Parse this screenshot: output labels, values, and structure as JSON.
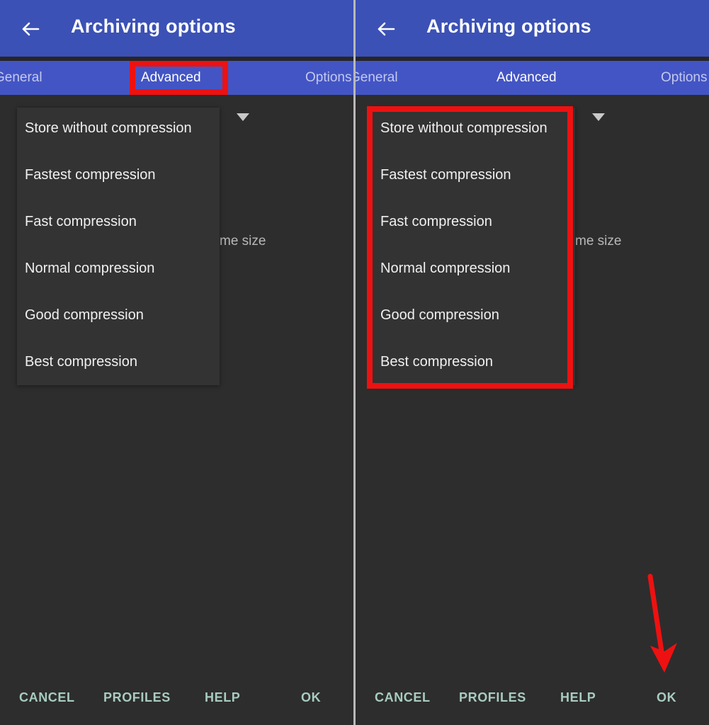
{
  "app": {
    "title": "Archiving options",
    "back_icon": "arrow-left-icon"
  },
  "tabs": {
    "general": "General",
    "advanced": "Advanced",
    "options": "Options",
    "selected": "Advanced"
  },
  "dropdown": {
    "caret_icon": "chevron-down-icon",
    "items": [
      "Store without compression",
      "Fastest compression",
      "Fast compression",
      "Normal compression",
      "Good compression",
      "Best compression"
    ]
  },
  "form": {
    "partial_label": "me size"
  },
  "actions": {
    "cancel": "CANCEL",
    "profiles": "PROFILES",
    "help": "HELP",
    "ok": "OK"
  },
  "annotations": {
    "tab_highlight_target": "Advanced",
    "list_highlight_target": "compression-level-list",
    "arrow_target": "OK",
    "color": "#ee1111"
  },
  "colors": {
    "appbar": "#3b51b5",
    "tabbar": "#4355c4",
    "background": "#2d2d2d",
    "dropdown_surface": "#333333",
    "action_text": "#a8ccc0",
    "annotation": "#ee1111"
  }
}
